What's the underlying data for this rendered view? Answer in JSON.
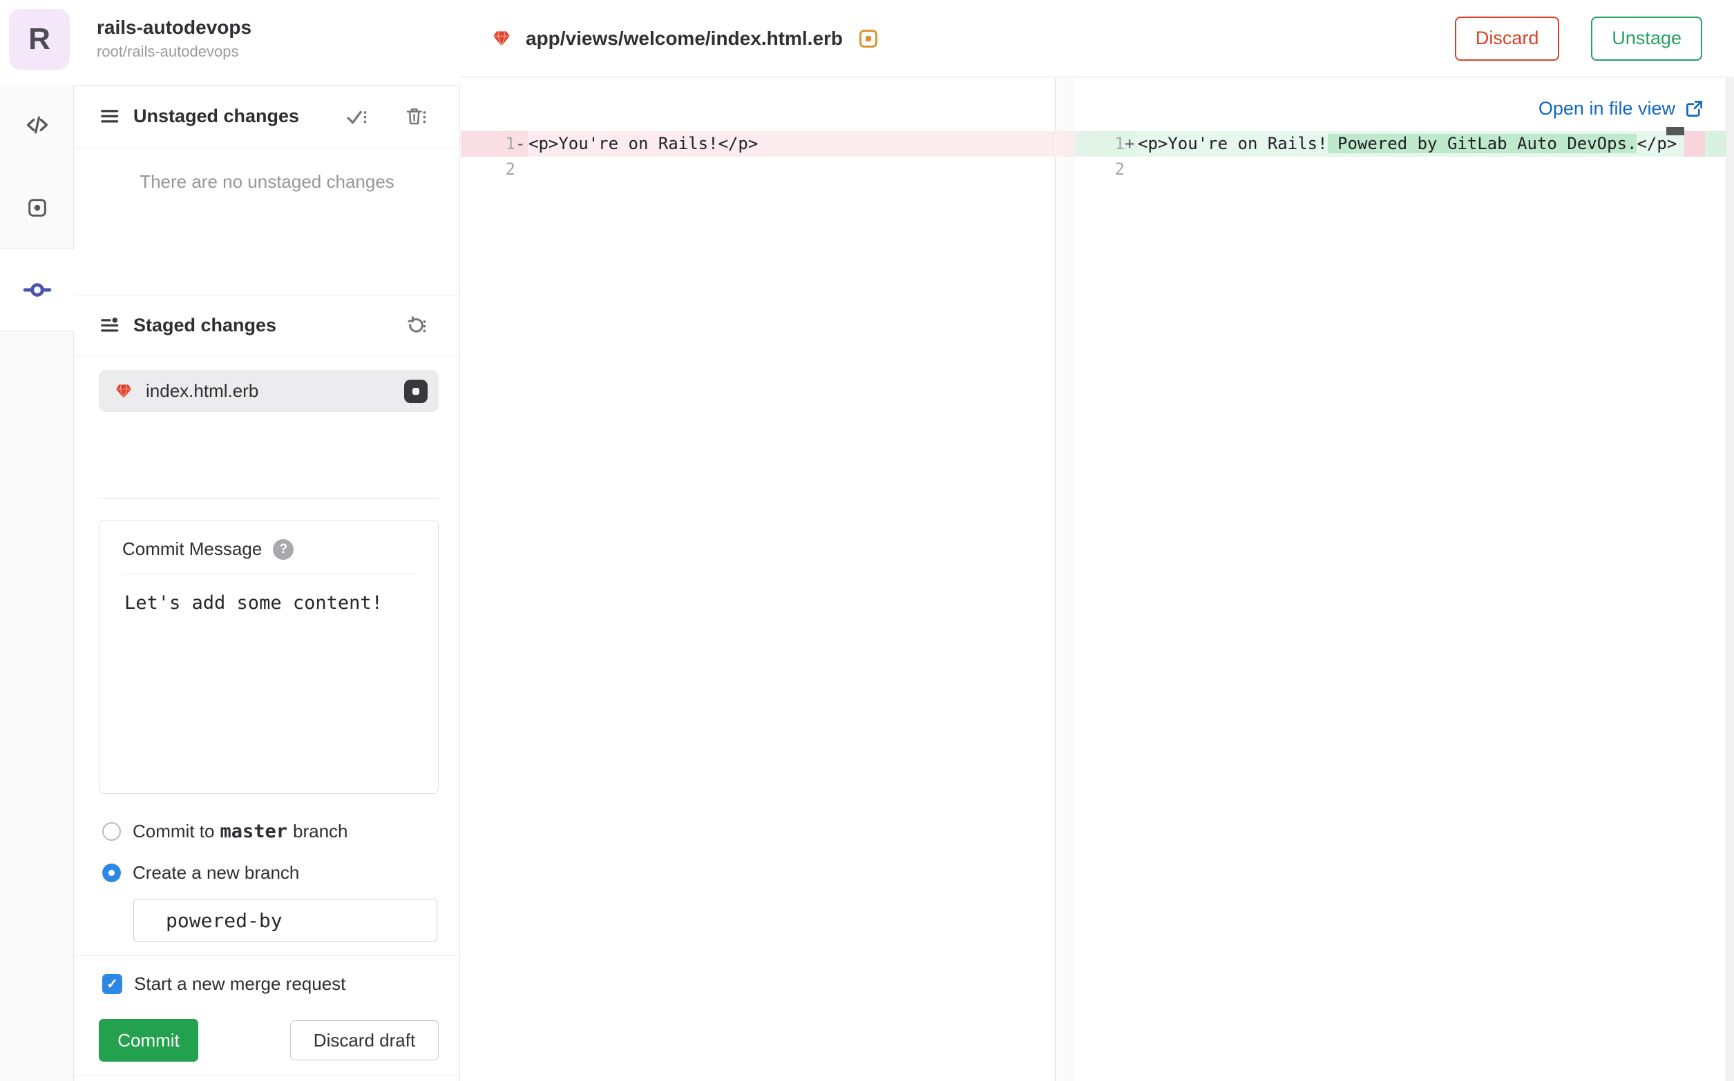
{
  "project": {
    "avatar_letter": "R",
    "title": "rails-autodevops",
    "path": "root/rails-autodevops"
  },
  "commit_panel": {
    "unstaged": {
      "title": "Unstaged changes",
      "empty": "There are no unstaged changes"
    },
    "staged": {
      "title": "Staged changes",
      "file_name": "index.html.erb"
    },
    "commit_box": {
      "label": "Commit Message",
      "message": "Let's add some content!"
    },
    "branch": {
      "commit_to_prefix": "Commit to",
      "branch_name": "master",
      "commit_to_suffix": "branch",
      "create_new_label": "Create a new branch",
      "new_branch_value": "powered-by"
    },
    "merge_request_label": "Start a new merge request",
    "commit_button": "Commit",
    "discard_draft_button": "Discard draft"
  },
  "diff": {
    "file_path": "app/views/welcome/index.html.erb",
    "discard_button": "Discard",
    "unstage_button": "Unstage",
    "open_link": "Open in file view",
    "left_line1_number": "1",
    "left_line1_marker": "-",
    "left_line1_code": "<p>You're on Rails!</p>",
    "left_line2_number": "2",
    "right_line1_number": "1",
    "right_line1_marker": "+",
    "right_line1_pre": "<p>You're on Rails!",
    "right_line1_added": " Powered by GitLab Auto DevOps.",
    "right_line1_post": "</p>",
    "right_line2_number": "2"
  },
  "colors": {
    "accent_blue": "#2e87e5",
    "link_blue": "#1068bf",
    "success_green": "#23a14f",
    "danger_red": "#dd4026",
    "active_tab_blue": "#4a54ae",
    "ruby_red": "#e2432c",
    "modified_orange": "#d99530",
    "deleted_line_bg": "#fcecef",
    "added_line_bg": "#e6f8ed",
    "added_word_bg": "#bfe9cd"
  }
}
